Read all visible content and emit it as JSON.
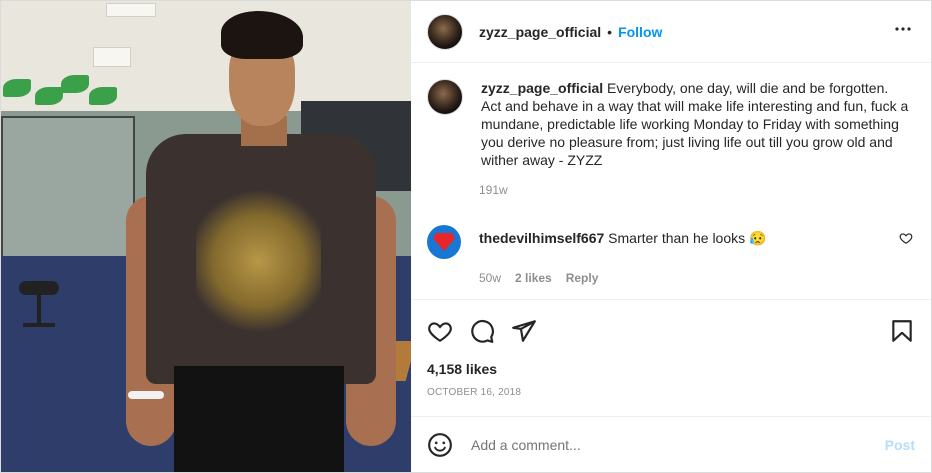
{
  "post": {
    "username": "zyzz_page_official",
    "separator": "•",
    "follow_label": "Follow",
    "more_label": "•••"
  },
  "caption": {
    "username": "zyzz_page_official",
    "text": "Everybody, one day, will die and be forgotten. Act and behave in a way that will make life interesting and fun, fuck a mundane, predictable life working Monday to Friday with something you derive no pleasure from; just living life out till you grow old and wither away - ZYZZ",
    "age": "191w"
  },
  "comments": [
    {
      "username": "thedevilhimself667",
      "text": "Smarter than he looks 😥",
      "age": "50w",
      "likes": "2 likes",
      "reply_label": "Reply"
    }
  ],
  "footer": {
    "likes": "4,158 likes",
    "date": "OCTOBER 16, 2018",
    "add_comment_placeholder": "Add a comment...",
    "post_label": "Post"
  },
  "colors": {
    "accent": "#0095f6",
    "post_disabled": "#b2dffc",
    "muted": "#8e8e8e"
  },
  "icons": [
    "heart-icon",
    "comment-icon",
    "share-icon",
    "bookmark-icon",
    "emoji-icon",
    "more-icon"
  ]
}
